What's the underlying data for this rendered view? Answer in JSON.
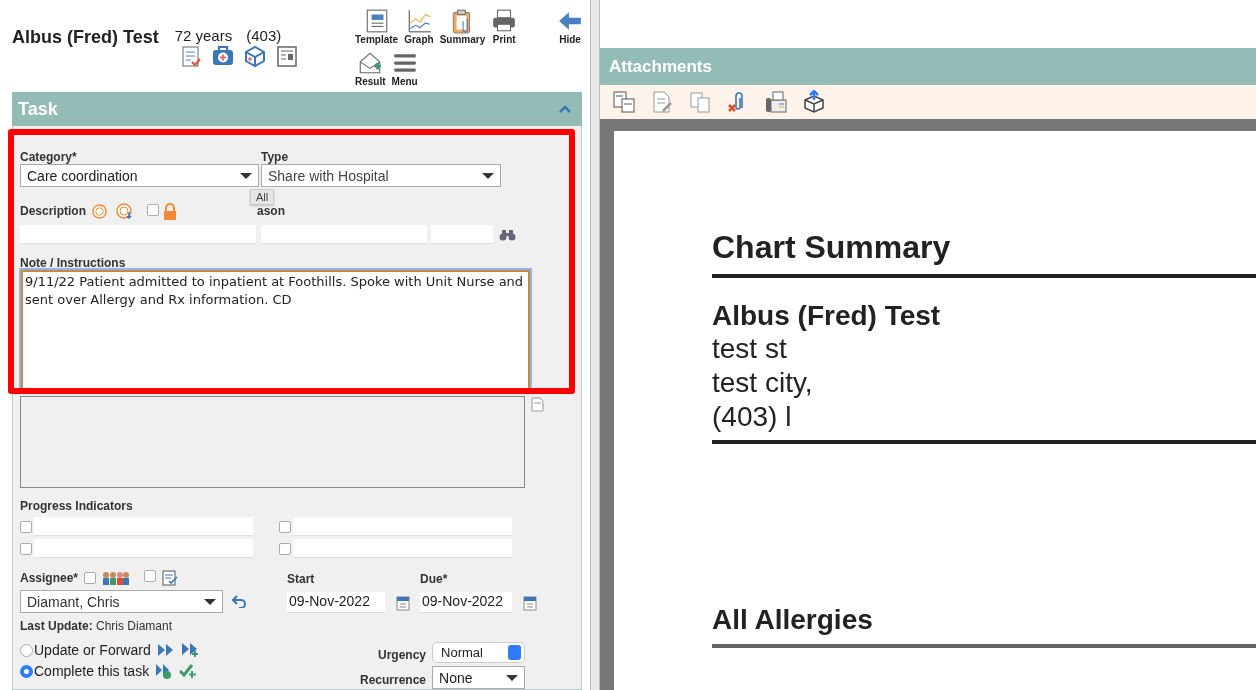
{
  "patient": {
    "name": "Albus (Fred) Test",
    "age": "72 years",
    "phone": "(403)"
  },
  "toolbar": [
    {
      "label": "Template"
    },
    {
      "label": "Graph"
    },
    {
      "label": "Summary"
    },
    {
      "label": "Print"
    },
    {
      "label": "Hide"
    },
    {
      "label": "Result"
    },
    {
      "label": "Menu"
    }
  ],
  "task": {
    "title": "Task",
    "expanded": true,
    "category": {
      "label": "Category*",
      "value": "Care coordination"
    },
    "type": {
      "label": "Type",
      "value": "Share with Hospital"
    },
    "tooltip": "All",
    "description": {
      "label": "Description",
      "checked": false
    },
    "reason_label": "ason",
    "note": {
      "label": "Note / Instructions",
      "value": "9/11/22 Patient admitted to inpatient at Foothills. Spoke with Unit Nurse and sent over Allergy and Rx information. CD"
    },
    "progress": {
      "label": "Progress Indicators",
      "items": [
        {
          "checked": false
        },
        {
          "checked": false
        },
        {
          "checked": false
        },
        {
          "checked": false
        }
      ]
    },
    "assignee": {
      "label": "Assignee*",
      "group_checked": false,
      "note_checked": false,
      "value": "Diamant, Chris"
    },
    "start": {
      "label": "Start",
      "value": "09-Nov-2022"
    },
    "due": {
      "label": "Due*",
      "value": "09-Nov-2022"
    },
    "last_update": "**Last Update:** Chris Diamant",
    "actions": [
      {
        "label": "Update or Forward",
        "selected": false
      },
      {
        "label": "Complete this task",
        "selected": true
      }
    ],
    "urgency": {
      "label": "Urgency",
      "value": "Normal"
    },
    "recurrence": {
      "label": "Recurrence",
      "value": "None"
    }
  },
  "attachments": {
    "title": "Attachments"
  },
  "document": {
    "heading": "Chart Summary",
    "patient_name": "Albus (Fred) Test",
    "address_lines": [
      "test st",
      "test city,",
      "(403) l"
    ],
    "section": "All Allergies"
  }
}
